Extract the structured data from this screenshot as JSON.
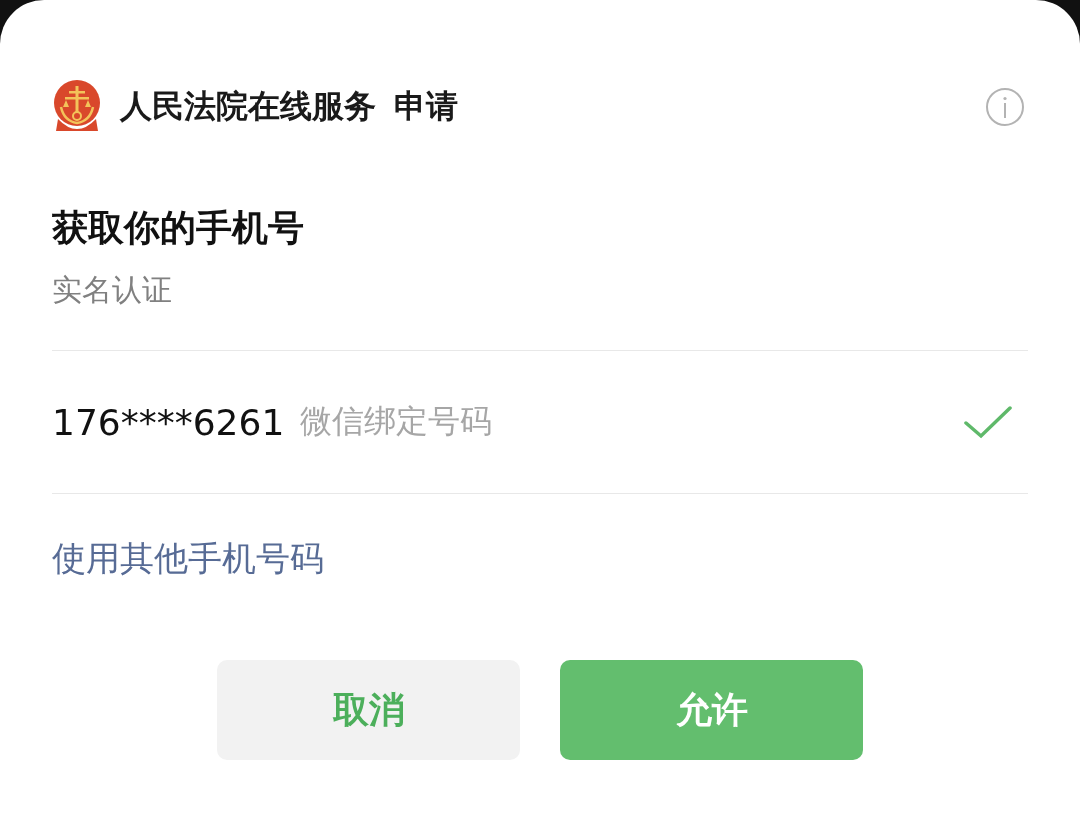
{
  "header": {
    "app_name": "人民法院在线服务",
    "action": "申请"
  },
  "title": "获取你的手机号",
  "subtitle": "实名认证",
  "phone_options": [
    {
      "number": "176****6261",
      "note": "微信绑定号码",
      "selected": true
    }
  ],
  "other_link": "使用其他手机号码",
  "buttons": [
    {
      "label": "取消",
      "kind": "secondary"
    },
    {
      "label": "允许",
      "kind": "primary"
    }
  ]
}
